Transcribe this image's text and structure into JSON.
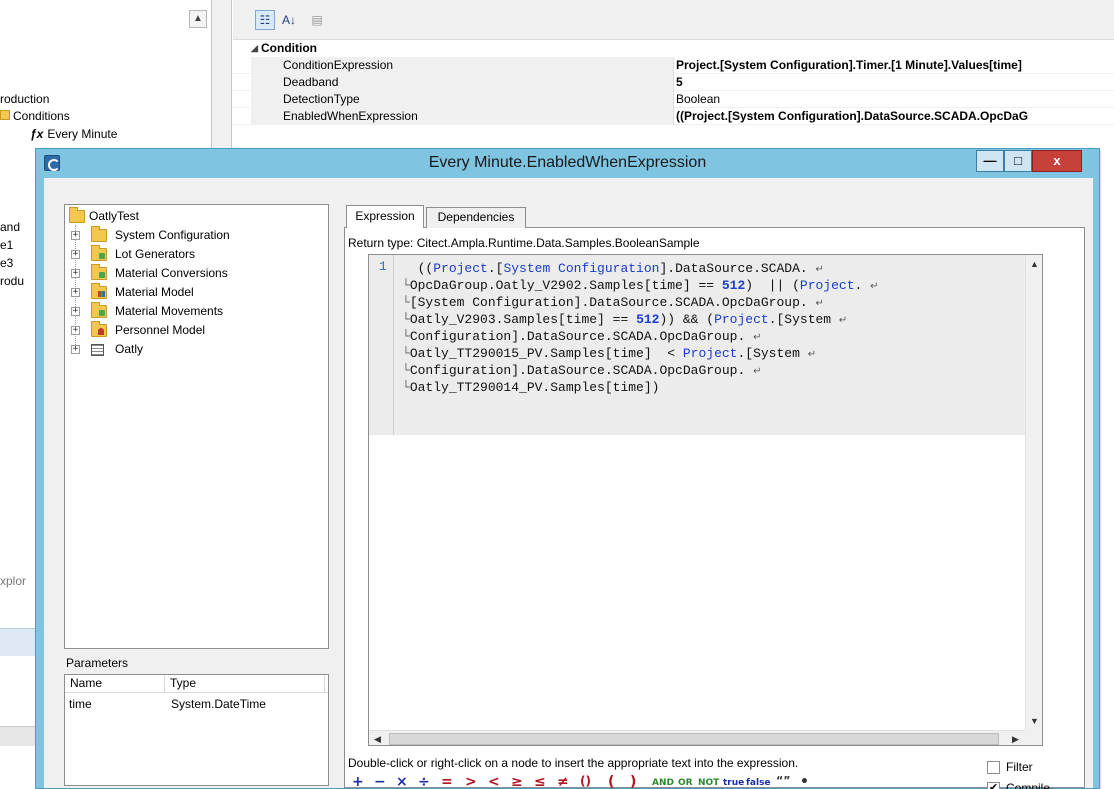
{
  "background": {
    "tree_lines": [
      {
        "text": "roduction"
      },
      {
        "text": "Conditions"
      },
      {
        "text": "Every Minute"
      },
      {
        "text": "and"
      },
      {
        "text": "e1"
      },
      {
        "text": "e3"
      },
      {
        "text": "rodu"
      },
      {
        "text": "xplor"
      }
    ],
    "props": {
      "category": "Condition",
      "rows": [
        {
          "name": "ConditionExpression",
          "value": "Project.[System Configuration].Timer.[1 Minute].Values[time]",
          "bold": true
        },
        {
          "name": "Deadband",
          "value": "5",
          "bold": true
        },
        {
          "name": "DetectionType",
          "value": "Boolean",
          "bold": false
        },
        {
          "name": "EnabledWhenExpression",
          "value": "((Project.[System Configuration].DataSource.SCADA.OpcDaG",
          "bold": true
        }
      ]
    }
  },
  "dialog": {
    "title": "Every Minute.EnabledWhenExpression",
    "buttons": {
      "minimize": "—",
      "maximize": "□",
      "close": "x"
    },
    "tree": {
      "root": "OatlyTest",
      "items": [
        "System Configuration",
        "Lot Generators",
        "Material Conversions",
        "Material Model",
        "Material Movements",
        "Personnel Model",
        "Oatly"
      ]
    },
    "parameters": {
      "label": "Parameters",
      "columns": [
        "Name",
        "Type"
      ],
      "rows": [
        {
          "name": "time",
          "type": "System.DateTime"
        }
      ]
    },
    "tabs": [
      "Expression",
      "Dependencies"
    ],
    "return_type": "Return type: Citect.Ampla.Runtime.Data.Samples.BooleanSample",
    "line_number": "1",
    "hint": "Double-click or right-click on a node to insert the appropriate text into the expression.",
    "operators": [
      "+",
      "−",
      "×",
      "÷",
      "=",
      ">",
      "<",
      "≥",
      "≤",
      "≠",
      "()",
      "(",
      ")",
      "AND",
      "OR",
      "NOT",
      "true",
      "false",
      "“”",
      "•"
    ],
    "filter_label": "Filter",
    "compile_label": "Compile",
    "filter_checked": false,
    "compile_checked": true
  }
}
